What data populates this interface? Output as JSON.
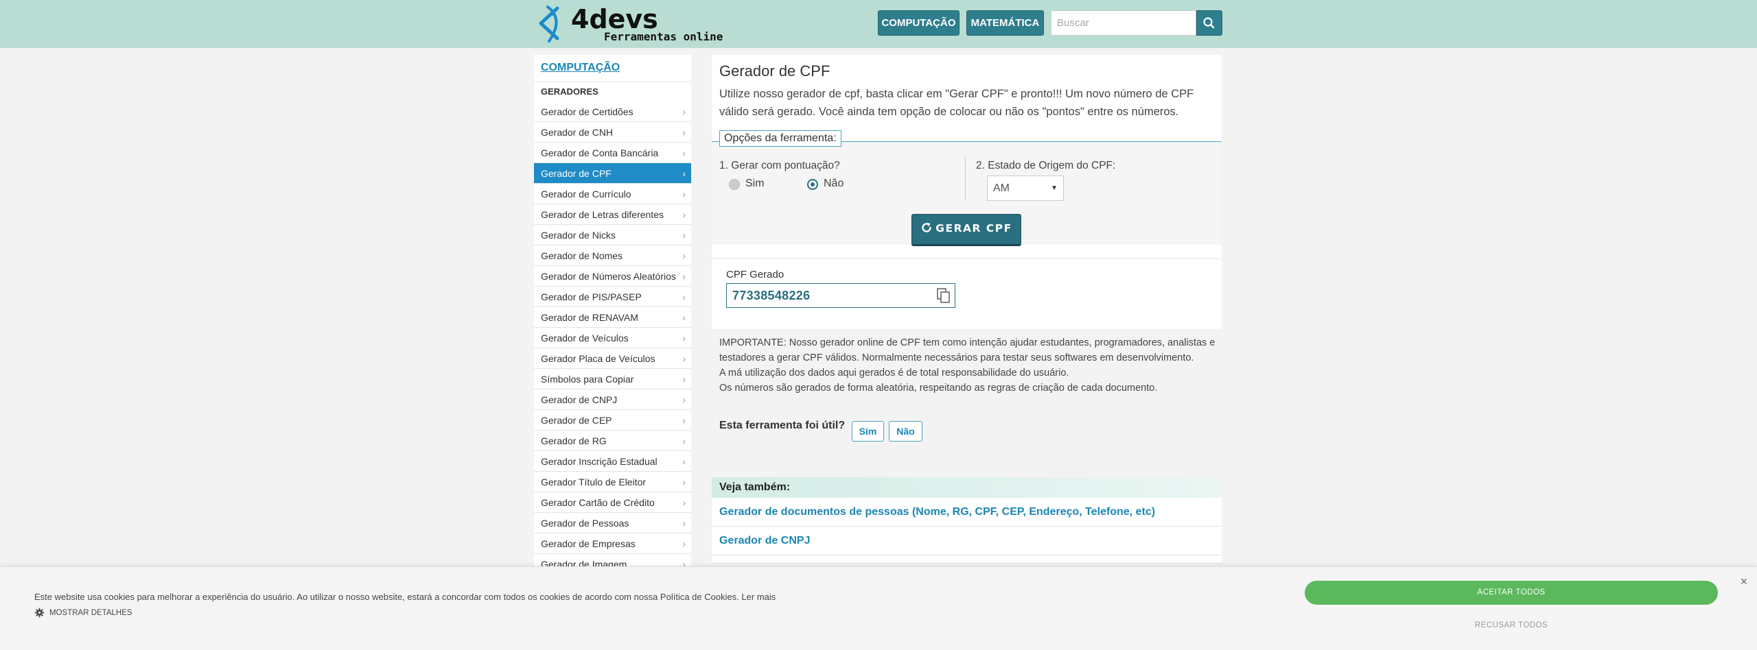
{
  "header": {
    "logo_title": "4devs",
    "logo_subtitle": "Ferramentas online",
    "nav": [
      "COMPUTAÇÃO",
      "MATEMÁTICA"
    ],
    "search_placeholder": "Buscar"
  },
  "sidebar": {
    "category": "COMPUTAÇÃO",
    "section": "GERADORES",
    "items": [
      "Gerador de Certidões",
      "Gerador de CNH",
      "Gerador de Conta Bancária",
      "Gerador de CPF",
      "Gerador de Currículo",
      "Gerador de Letras diferentes",
      "Gerador de Nicks",
      "Gerador de Nomes",
      "Gerador de Números Aleatórios",
      "Gerador de PIS/PASEP",
      "Gerador de RENAVAM",
      "Gerador de Veículos",
      "Gerador Placa de Veículos",
      "Símbolos para Copiar",
      "Gerador de CNPJ",
      "Gerador de CEP",
      "Gerador de RG",
      "Gerador Inscrição Estadual",
      "Gerador Título de Eleitor",
      "Gerador Cartão de Crédito",
      "Gerador de Pessoas",
      "Gerador de Empresas",
      "Gerador de Imagem"
    ],
    "active_index": 3
  },
  "tool": {
    "title": "Gerador de CPF",
    "description": "Utilize nosso gerador de cpf, basta clicar em \"Gerar CPF\" e pronto!!! Um novo número de CPF válido será gerado. Você ainda tem opção de colocar ou não os \"pontos\" entre os números.",
    "options_label": "Opções da ferramenta:",
    "option1_label": "1. Gerar com pontuação?",
    "option1_yes": "Sim",
    "option1_no": "Não",
    "option1_selected": "Não",
    "option2_label": "2. Estado de Origem do CPF:",
    "option2_value": "AM",
    "generate_button": "GERAR CPF",
    "result_label": "CPF Gerado",
    "result_value": "77338548226"
  },
  "important": [
    "IMPORTANTE: Nosso gerador online de CPF tem como intenção ajudar estudantes, programadores, analistas e testadores a gerar CPF válidos. Normalmente necessários para testar seus softwares em desenvolvimento.",
    "A má utilização dos dados aqui gerados é de total responsabilidade do usuário.",
    "Os números são gerados de forma aleatória, respeitando as regras de criação de cada documento."
  ],
  "feedback": {
    "question": "Esta ferramenta foi útil?",
    "yes": "Sim",
    "no": "Não"
  },
  "see_also": {
    "title": "Veja também:",
    "items": [
      "Gerador de documentos de pessoas (Nome, RG, CPF, CEP, Endereço, Telefone, etc)",
      "Gerador de CNPJ"
    ]
  },
  "cookie": {
    "text": "Este website usa cookies para melhorar a experiência do usuário. Ao utilizar o nosso website, estará a concordar com todos os cookies de acordo com nossa Política de Cookies. Ler mais",
    "details": "Mostrar detalhes",
    "accept": "Aceitar todos",
    "reject": "Recusar todos",
    "close": "×"
  },
  "colors": {
    "header_bg": "#b9ddd3",
    "accent": "#2a6f80",
    "link": "#1b86b3",
    "active_item": "#1f8bc7",
    "accept_button": "#5cb85c"
  }
}
